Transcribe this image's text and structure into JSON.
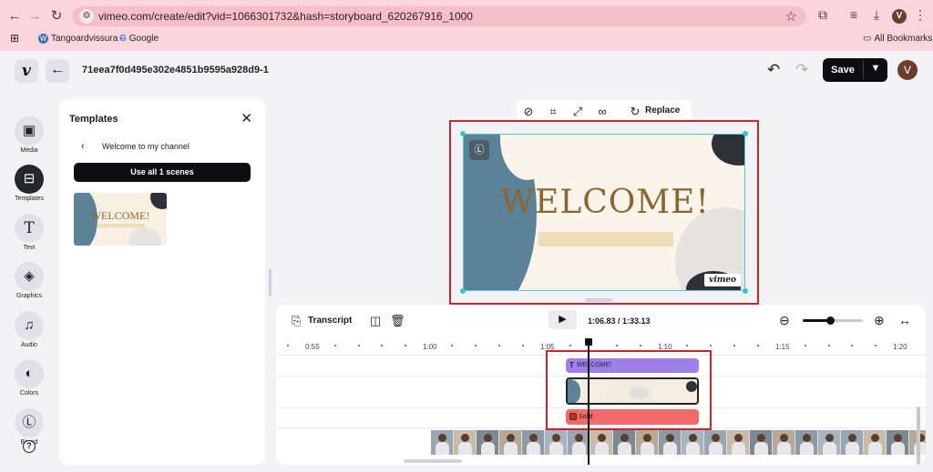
{
  "browser": {
    "url": "vimeo.com/create/edit?vid=1066301732&hash=storyboard_620267916_1000",
    "profile_initial": "V",
    "bookmarks": [
      {
        "label": "Tangoardvissura -",
        "icon": "wordpress-icon"
      },
      {
        "label": "Google",
        "icon": "google-icon"
      }
    ],
    "all_bookmarks_label": "All Bookmarks"
  },
  "header": {
    "video_id": "71eea7f0d495e302e4851b9595a928d9-1",
    "save_label": "Save",
    "avatar_initial": "V"
  },
  "rail": [
    {
      "label": "Media",
      "icon": "media-icon",
      "active": false
    },
    {
      "label": "Templates",
      "icon": "templates-icon",
      "active": true
    },
    {
      "label": "Text",
      "icon": "text-icon",
      "active": false
    },
    {
      "label": "Graphics",
      "icon": "graphics-icon",
      "active": false
    },
    {
      "label": "Audio",
      "icon": "audio-icon",
      "active": false
    },
    {
      "label": "Colors",
      "icon": "colors-icon",
      "active": false
    },
    {
      "label": "Brand",
      "icon": "brand-icon",
      "active": false
    }
  ],
  "templates_panel": {
    "title": "Templates",
    "breadcrumb": "Welcome to my channel",
    "use_all_label": "Use all 1 scenes",
    "thumbnail_title": "WELCOME!"
  },
  "canvas_toolbar": {
    "replace_label": "Replace"
  },
  "preview": {
    "title": "WELCOME!",
    "brand": "vimeo"
  },
  "timeline": {
    "transcript_label": "Transcript",
    "current_time": "1:06.83",
    "total_time": "1:33.13",
    "time_display": "1:06.83 / 1:33.13",
    "zoom_level": 0.45,
    "ruler_ticks": [
      "0:55",
      "1:00",
      "1:05",
      "1:10",
      "1:15",
      "1:20"
    ],
    "text_clip_label": "WELCOME!",
    "solid_clip_label": "Solid"
  },
  "colors": {
    "accent_dark": "#0e0e12",
    "text_clip": "#a07ee8",
    "solid_clip": "#f06a6c",
    "highlight_box": "#c8262f",
    "selection": "#36c1d8",
    "template_gold": "#8a6730",
    "template_blue": "#5b8296"
  }
}
